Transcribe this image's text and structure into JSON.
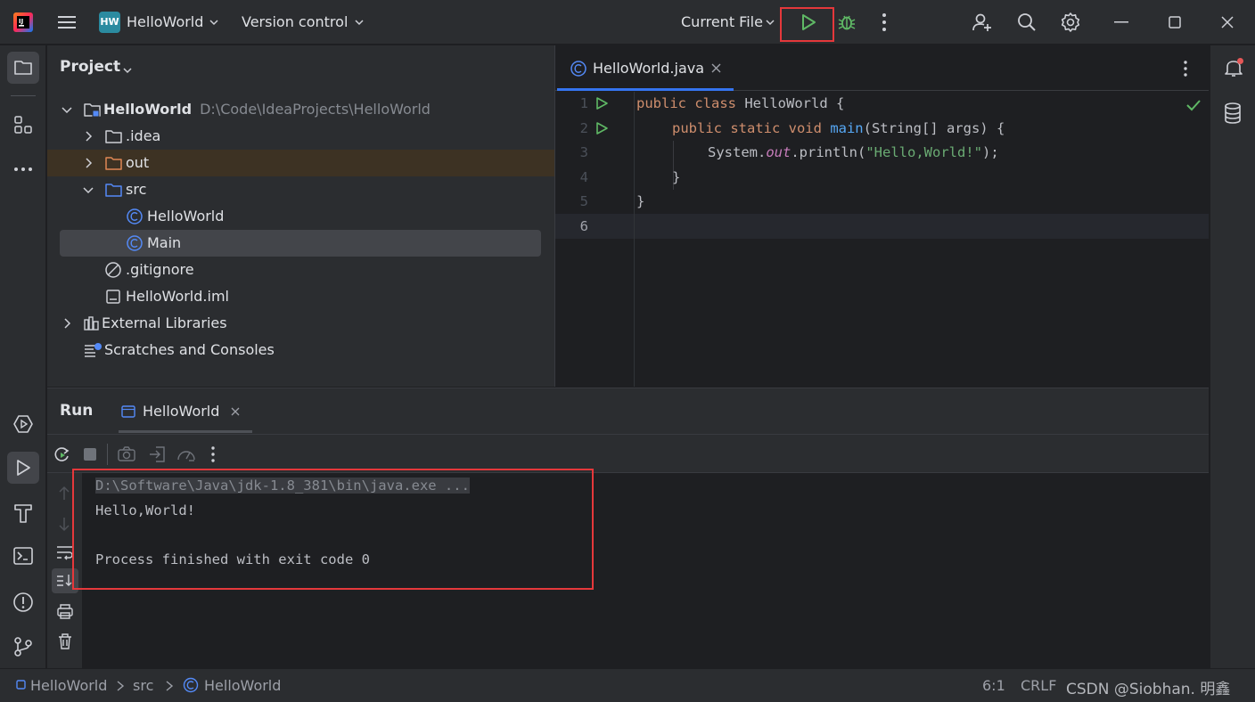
{
  "titlebar": {
    "project_badge": "HW",
    "project_name": "HelloWorld",
    "vcs_label": "Version control",
    "run_config": "Current File"
  },
  "project_panel": {
    "title": "Project",
    "tree": [
      {
        "label": "HelloWorld",
        "hint": "D:\\Code\\IdeaProjects\\HelloWorld",
        "icon": "module-folder-icon"
      },
      {
        "label": ".idea",
        "icon": "folder-icon"
      },
      {
        "label": "out",
        "icon": "excluded-folder-icon"
      },
      {
        "label": "src",
        "icon": "source-folder-icon"
      },
      {
        "label": "HelloWorld",
        "icon": "class-icon"
      },
      {
        "label": "Main",
        "icon": "class-icon"
      },
      {
        "label": ".gitignore",
        "icon": "ignore-file-icon"
      },
      {
        "label": "HelloWorld.iml",
        "icon": "iml-file-icon"
      },
      {
        "label": "External Libraries",
        "icon": "libraries-icon"
      },
      {
        "label": "Scratches and Consoles",
        "icon": "scratches-icon"
      }
    ]
  },
  "editor": {
    "tab_label": "HelloWorld.java",
    "line_numbers": [
      "1",
      "2",
      "3",
      "4",
      "5",
      "6"
    ],
    "code": {
      "l1_kw": "public class ",
      "l1_rest": "HelloWorld {",
      "l2_kw": "public static void ",
      "l2_fn": "main",
      "l2_rest": "(String[] args) {",
      "l3_a": "System.",
      "l3_fld": "out",
      "l3_b": ".println(",
      "l3_str": "\"Hello,World!\"",
      "l3_c": ");",
      "l4": "}",
      "l5": "}"
    }
  },
  "run_panel": {
    "title": "Run",
    "tab_label": "HelloWorld",
    "console": {
      "command": "D:\\Software\\Java\\jdk-1.8_381\\bin\\java.exe ...",
      "output": "Hello,World!",
      "exit": "Process finished with exit code 0"
    }
  },
  "statusbar": {
    "crumbs": [
      "HelloWorld",
      "src",
      "HelloWorld"
    ],
    "position": "6:1",
    "line_sep": "CRLF",
    "watermark": "CSDN @Siobhan. 明鑫"
  },
  "colors": {
    "accent": "#3574f0",
    "run_green": "#5fb865",
    "highlight_red": "#e5383b"
  }
}
